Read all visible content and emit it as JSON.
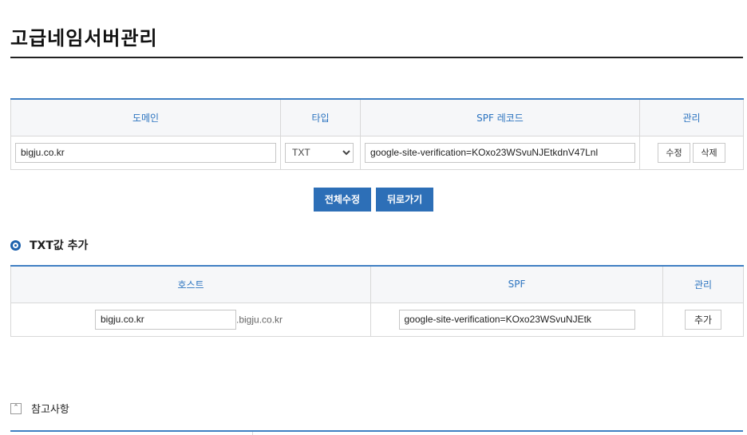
{
  "page": {
    "title": "고급네임서버관리"
  },
  "dns_table": {
    "headers": {
      "domain": "도메인",
      "type": "타입",
      "spf": "SPF 레코드",
      "manage": "관리"
    },
    "row": {
      "domain": "bigju.co.kr",
      "type": "TXT",
      "spf": "google-site-verification=KOxo23WSvuNJEtkdnV47Lnl",
      "edit": "수정",
      "delete": "삭제"
    }
  },
  "actions": {
    "edit_all": "전체수정",
    "back": "뒤로가기"
  },
  "add_section": {
    "title": "TXT값 추가",
    "headers": {
      "host": "호스트",
      "spf": "SPF",
      "manage": "관리"
    },
    "row": {
      "host": "bigju.co.kr",
      "suffix": ".bigju.co.kr",
      "spf": "google-site-verification=KOxo23WSvuNJEtk",
      "add": "추가"
    }
  },
  "notes": {
    "title": "참고사항"
  },
  "colors": {
    "accent": "#2d6fb7",
    "header_text": "#2c74c0",
    "border_top": "#3f7fc3"
  }
}
